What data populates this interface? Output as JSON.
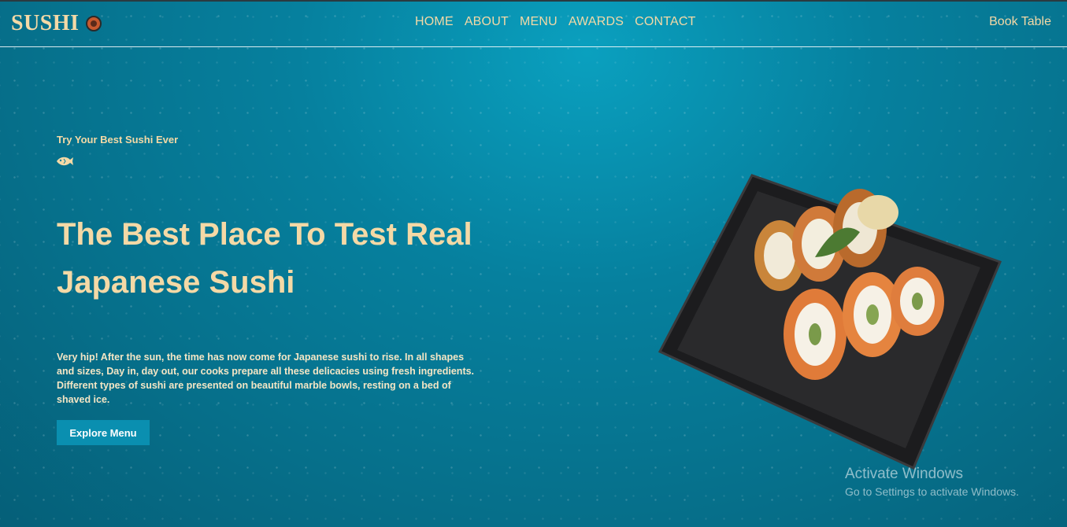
{
  "header": {
    "logo_text": "SUSHI",
    "nav": [
      "HOME",
      "ABOUT",
      "MENU",
      "AWARDS",
      "CONTACT"
    ],
    "cta": "Book Table"
  },
  "hero": {
    "tagline": "Try Your Best Sushi Ever",
    "title": "The Best Place To Test Real Japanese Sushi",
    "description": "Very hip! After the sun, the time has now come for Japanese sushi to rise. In all shapes and sizes, Day in, day out, our cooks prepare all these delicacies using fresh ingredients. Different types of sushi are presented on beautiful marble bowls, resting on a bed of shaved ice.",
    "button": "Explore Menu"
  },
  "watermark": {
    "title": "Activate Windows",
    "subtitle": "Go to Settings to activate Windows."
  },
  "icons": [
    "sushi-logo-icon",
    "fish-icon",
    "sushi-plate-image"
  ],
  "colors": {
    "accent": "#f4d9a6",
    "button": "#0a8fb0",
    "background": "#06809e"
  }
}
